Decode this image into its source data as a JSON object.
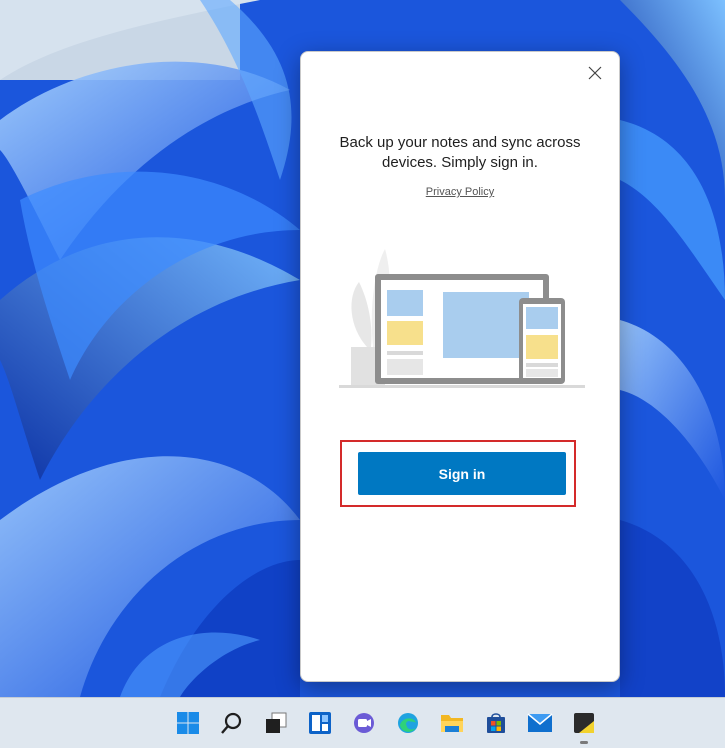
{
  "dialog": {
    "headline": "Back up your notes and sync across devices. Simply sign in.",
    "privacy_link": "Privacy Policy",
    "sign_in_label": "Sign in",
    "close_icon": "close-icon",
    "illustration": "laptop-phone-sync-illustration"
  },
  "taskbar": {
    "items": [
      {
        "name": "start",
        "icon": "windows-logo-icon"
      },
      {
        "name": "search",
        "icon": "search-icon"
      },
      {
        "name": "task-view",
        "icon": "task-view-icon"
      },
      {
        "name": "widgets",
        "icon": "widgets-icon"
      },
      {
        "name": "teams-chat",
        "icon": "chat-icon"
      },
      {
        "name": "edge",
        "icon": "edge-icon"
      },
      {
        "name": "file-explorer",
        "icon": "folder-icon"
      },
      {
        "name": "store",
        "icon": "store-icon"
      },
      {
        "name": "mail",
        "icon": "mail-icon"
      },
      {
        "name": "sticky-notes",
        "icon": "sticky-notes-icon"
      }
    ],
    "active_app": "sticky-notes"
  },
  "colors": {
    "accent": "#0078c2",
    "highlight": "#d42a2a",
    "wallpaper": "#1a5ae0"
  }
}
